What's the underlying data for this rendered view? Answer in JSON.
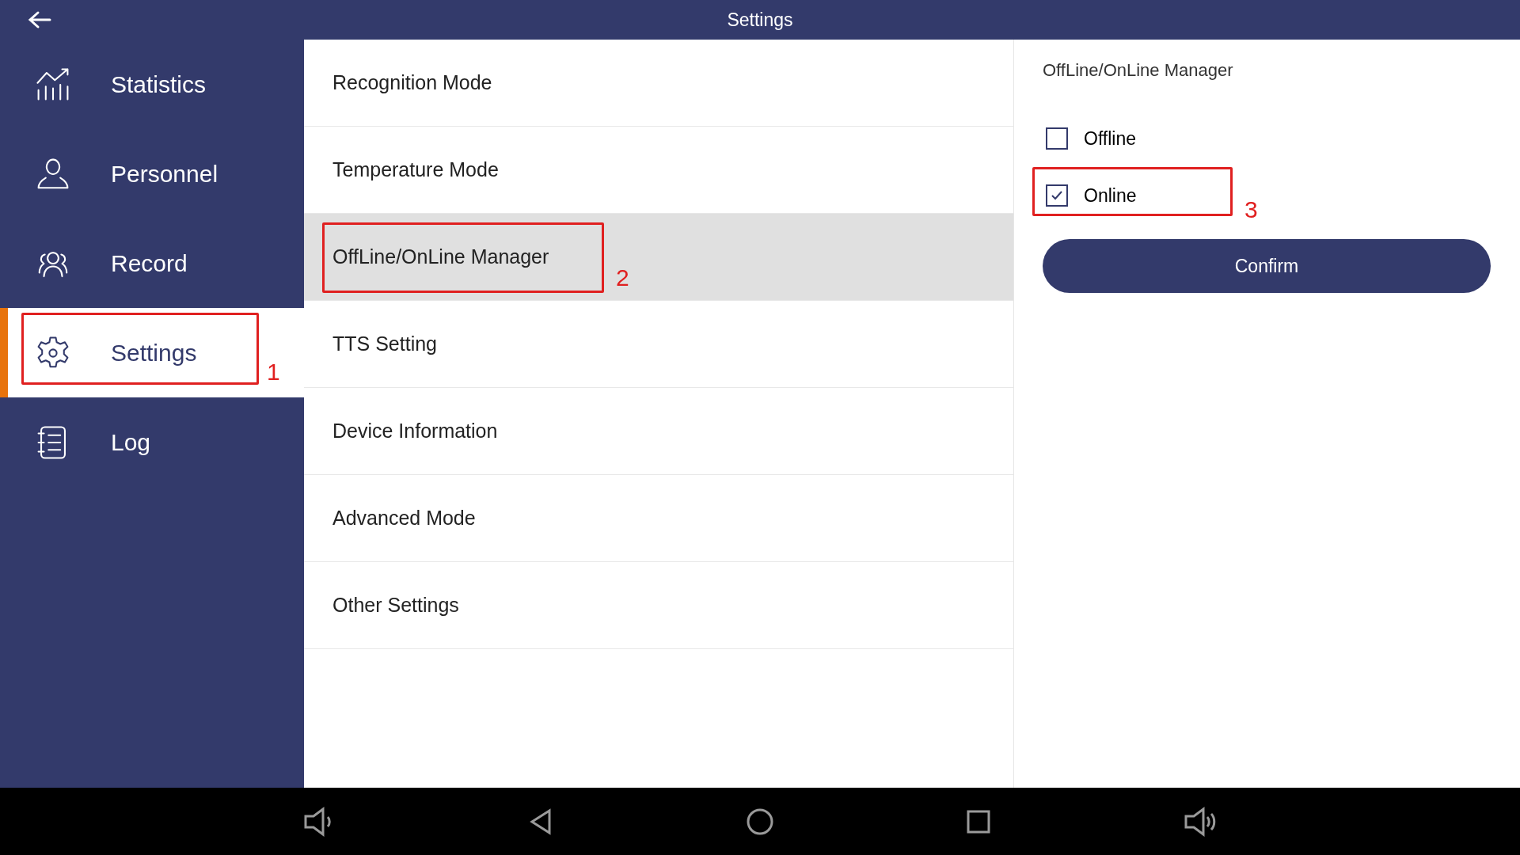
{
  "top_bar": {
    "title": "Settings"
  },
  "sidebar": {
    "items": [
      {
        "label": "Statistics",
        "selected": false
      },
      {
        "label": "Personnel",
        "selected": false
      },
      {
        "label": "Record",
        "selected": false
      },
      {
        "label": "Settings",
        "selected": true
      },
      {
        "label": "Log",
        "selected": false
      }
    ]
  },
  "menu": {
    "items": [
      {
        "label": "Recognition Mode",
        "selected": false
      },
      {
        "label": "Temperature Mode",
        "selected": false
      },
      {
        "label": "OffLine/OnLine Manager",
        "selected": true
      },
      {
        "label": "TTS Setting",
        "selected": false
      },
      {
        "label": "Device Information",
        "selected": false
      },
      {
        "label": "Advanced Mode",
        "selected": false
      },
      {
        "label": "Other Settings",
        "selected": false
      }
    ]
  },
  "panel": {
    "title": "OffLine/OnLine Manager",
    "options": [
      {
        "label": "Offline",
        "checked": false
      },
      {
        "label": "Online",
        "checked": true
      }
    ],
    "confirm": "Confirm"
  },
  "annotations": [
    {
      "label": "1"
    },
    {
      "label": "2"
    },
    {
      "label": "3"
    }
  ]
}
